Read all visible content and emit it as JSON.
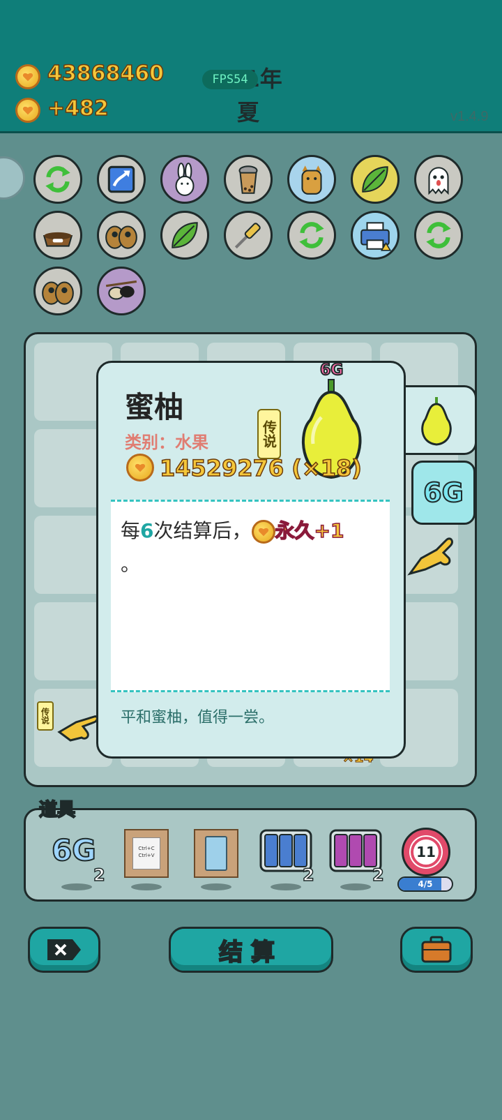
{
  "hud": {
    "coins": "43868460",
    "income": "+482",
    "fps": "FPS54",
    "year": "101年",
    "season": "夏",
    "version": "v1.4.9"
  },
  "card": {
    "name": "蜜柚",
    "category": "类别：水果",
    "rarity": "传说",
    "value": "14529276 (×18)",
    "tier": "6G",
    "desc_pre": "每",
    "desc_num": "6",
    "desc_mid": "次结算后，",
    "desc_bonus": "永久+1",
    "desc_end": "。",
    "flavor": "平和蜜柚，值得一尝。"
  },
  "side": {
    "tier": "6G"
  },
  "board": {
    "rarity_small": "传说",
    "multiplier": "×14"
  },
  "props": {
    "label": "道具",
    "items": [
      {
        "name": "6G",
        "count": "2"
      },
      {
        "name": "ctrl-c-ctrl-v",
        "count": "",
        "top": "Ctrl+C",
        "bottom": "Ctrl+V"
      },
      {
        "name": "fridge",
        "count": ""
      },
      {
        "name": "reroll-cards-1",
        "count": "2"
      },
      {
        "name": "reroll-cards-2",
        "count": "2"
      },
      {
        "name": "target",
        "count": "",
        "value": "11",
        "progress": "4/5"
      }
    ]
  },
  "buttons": {
    "settle": "结算"
  },
  "icons": [
    "recycle-icon",
    "arrow-box-icon",
    "rabbit-icon",
    "bubble-tea-icon",
    "cat-icon",
    "leaf-icon",
    "ghost-icon",
    "cat-food-icon",
    "owl-pair-icon",
    "leaf-icon",
    "screwdriver-icon",
    "recycle-icon",
    "printer-icon",
    "recycle-icon",
    "owl-pair-icon",
    "eyepatch-icon"
  ],
  "colors": {
    "accent": "#1fa6a3",
    "topbar": "#0f7e79",
    "gold": "#f5c73a"
  }
}
